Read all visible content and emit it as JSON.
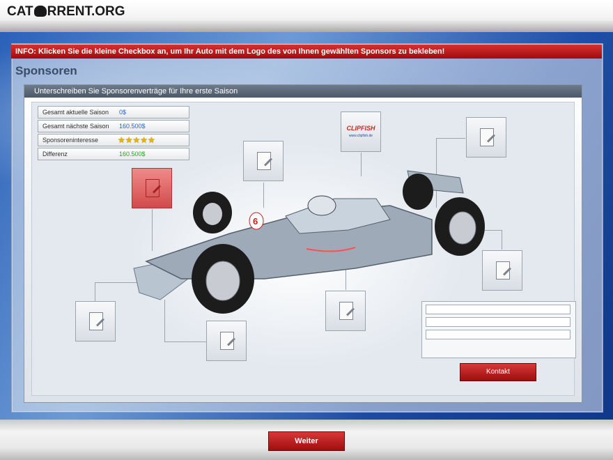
{
  "site": {
    "logo_left": "CAT",
    "logo_right": "RRENT.ORG"
  },
  "info_banner": "INFO: Klicken Sie die kleine Checkbox an, um Ihr Auto mit dem Logo des von Ihnen gewählten Sponsors zu bekleben!",
  "section_title": "Sponsoren",
  "panel_title": "Unterschreiben Sie Sponsorenverträge für Ihre erste Saison",
  "stats": [
    {
      "label": "Gesamt aktuelle Saison",
      "value": "0$",
      "color": "#2a62c8"
    },
    {
      "label": "Gesamt nächste Saison",
      "value": "160.500$",
      "color": "#2a62c8"
    },
    {
      "label": "Sponsoreninteresse",
      "stars": "★★★★★",
      "rating": 5,
      "max": 5
    },
    {
      "label": "Differenz",
      "value": "160.500$",
      "color": "#1aa81a"
    }
  ],
  "sponsor": {
    "logo": "CLIPFISH",
    "url": "www.clipfish.de"
  },
  "slots": [
    {
      "id": "slot-1",
      "state": "active",
      "icon": "contract-icon"
    },
    {
      "id": "slot-2",
      "state": "empty",
      "icon": "contract-icon"
    },
    {
      "id": "slot-3",
      "state": "sponsor",
      "icon": "clipfish-logo"
    },
    {
      "id": "slot-4",
      "state": "empty",
      "icon": "contract-icon"
    },
    {
      "id": "slot-5",
      "state": "empty",
      "icon": "contract-icon"
    },
    {
      "id": "slot-6",
      "state": "empty",
      "icon": "contract-icon"
    },
    {
      "id": "slot-7",
      "state": "empty",
      "icon": "contract-icon"
    },
    {
      "id": "slot-8",
      "state": "empty",
      "icon": "contract-icon"
    }
  ],
  "car": {
    "number": "6",
    "color": "#9eaab8"
  },
  "contact_button": "Kontakt",
  "next_button": "Weiter",
  "colors": {
    "accent_red": "#c41e1e",
    "panel_head": "#5a6778",
    "background_blue": "#2a61b8"
  }
}
